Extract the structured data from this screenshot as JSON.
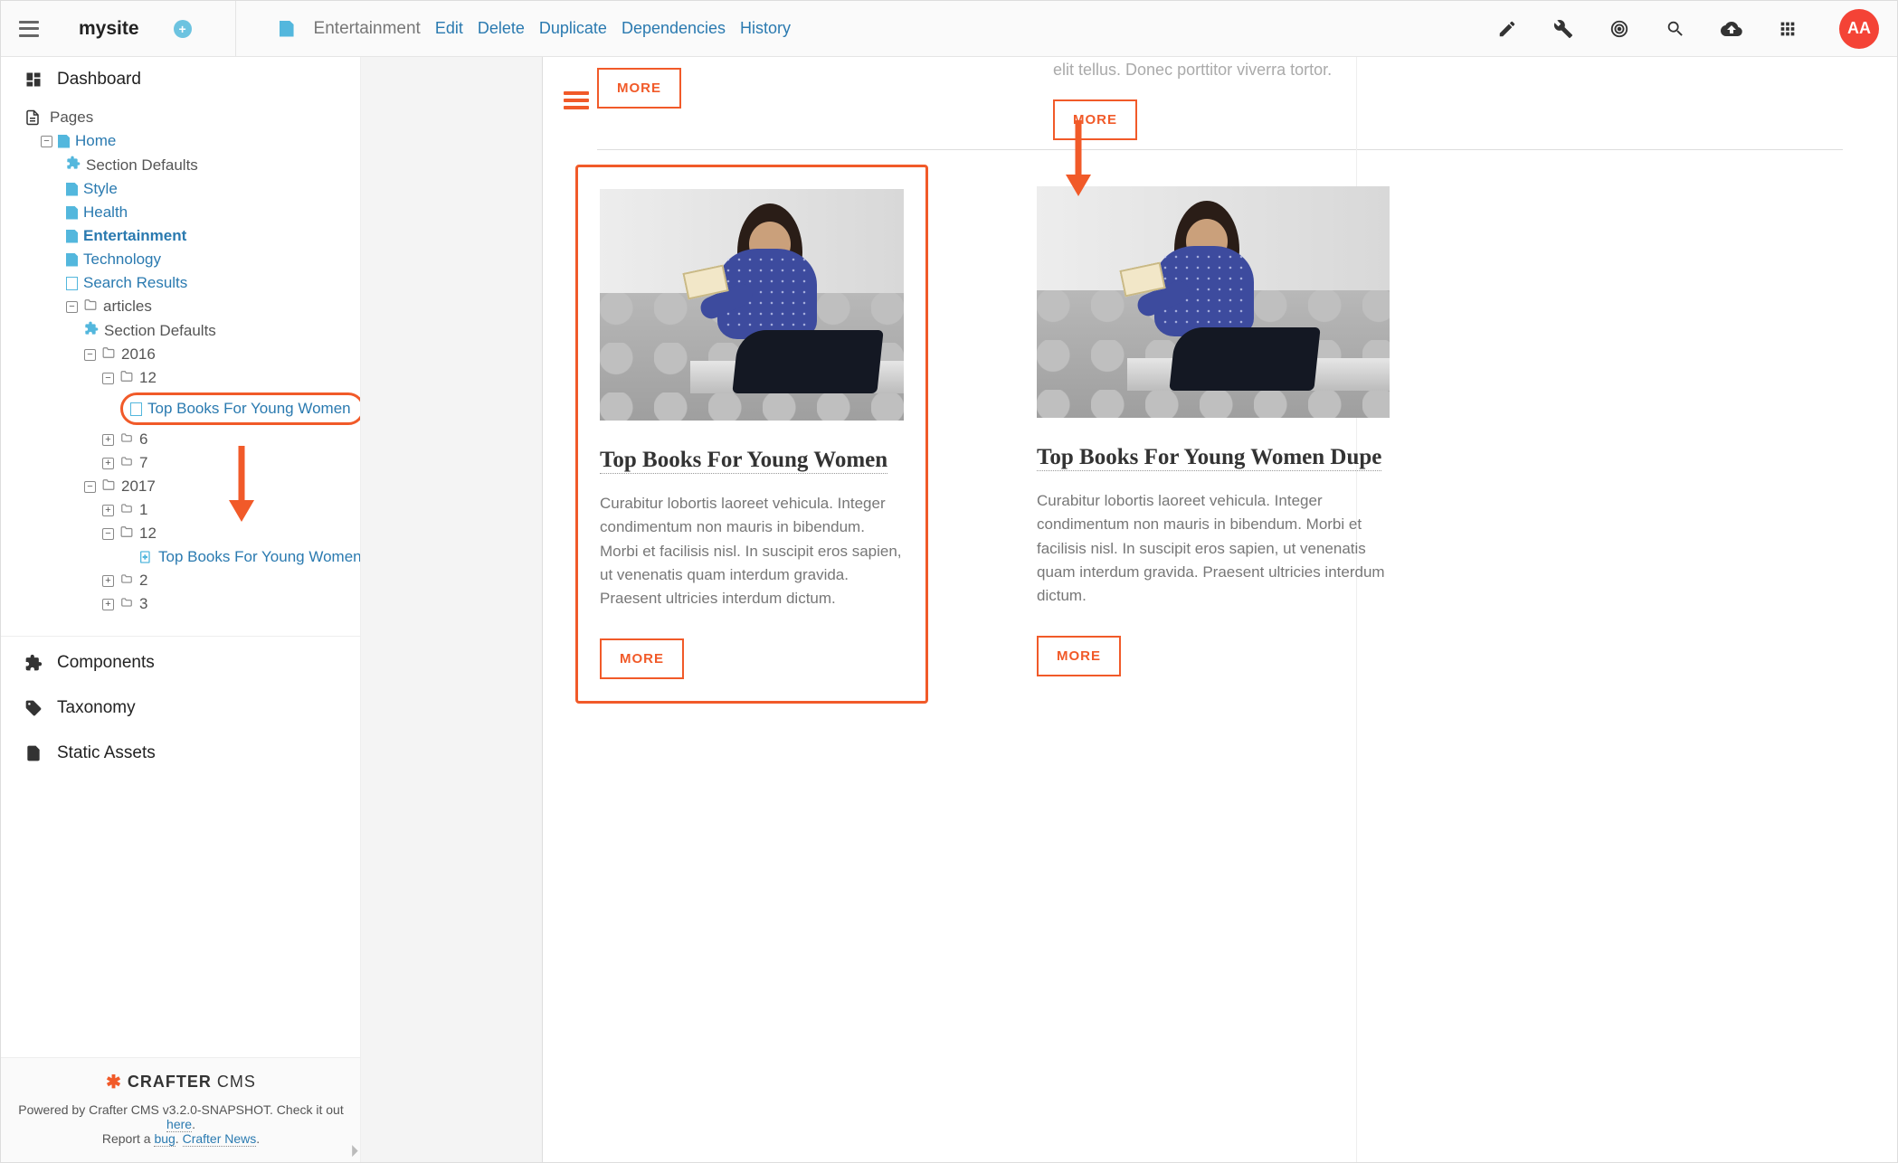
{
  "header": {
    "site_name": "mysite",
    "breadcrumb": "Entertainment",
    "actions": {
      "edit": "Edit",
      "delete": "Delete",
      "duplicate": "Duplicate",
      "dependencies": "Dependencies",
      "history": "History"
    },
    "avatar_initials": "AA"
  },
  "sidebar": {
    "dashboard": "Dashboard",
    "pages_label": "Pages",
    "home": "Home",
    "section_defaults": "Section Defaults",
    "style": "Style",
    "health": "Health",
    "entertainment": "Entertainment",
    "technology": "Technology",
    "search_results": "Search Results",
    "articles": "articles",
    "articles_section_defaults": "Section Defaults",
    "folder_2016": "2016",
    "folder_12a": "12",
    "item_top_books_a": "Top Books For Young Women",
    "folder_6": "6",
    "folder_7": "7",
    "folder_2017": "2017",
    "folder_1": "1",
    "folder_12b": "12",
    "item_top_books_b": "Top Books For Young Women",
    "folder_2": "2",
    "folder_3": "3",
    "components": "Components",
    "taxonomy": "Taxonomy",
    "static_assets": "Static Assets"
  },
  "footer": {
    "brand": "CRAFTER",
    "brand_suffix": "CMS",
    "line1_a": "Powered by Crafter CMS v3.2.0-SNAPSHOT. Check it out ",
    "line1_link": "here",
    "line1_b": ".",
    "line2_a": "Report a ",
    "line2_link1": "bug",
    "line2_b": ". ",
    "line2_link2": "Crafter News",
    "line2_c": "."
  },
  "preview": {
    "truncated_tail": "elit tellus. Donec porttitor viverra tortor.",
    "more_label": "MORE",
    "card1": {
      "title": "Top Books For Young Women",
      "text": "Curabitur lobortis laoreet vehicula. Integer condimentum non mauris in bibendum. Morbi et facilisis nisl. In suscipit eros sapien, ut venenatis quam interdum gravida. Praesent ultricies interdum dictum."
    },
    "card2": {
      "title": "Top Books For Young Women Dupe",
      "text": "Curabitur lobortis laoreet vehicula. Integer condimentum non mauris in bibendum. Morbi et facilisis nisl. In suscipit eros sapien, ut venenatis quam interdum gravida. Praesent ultricies interdum dictum."
    }
  }
}
